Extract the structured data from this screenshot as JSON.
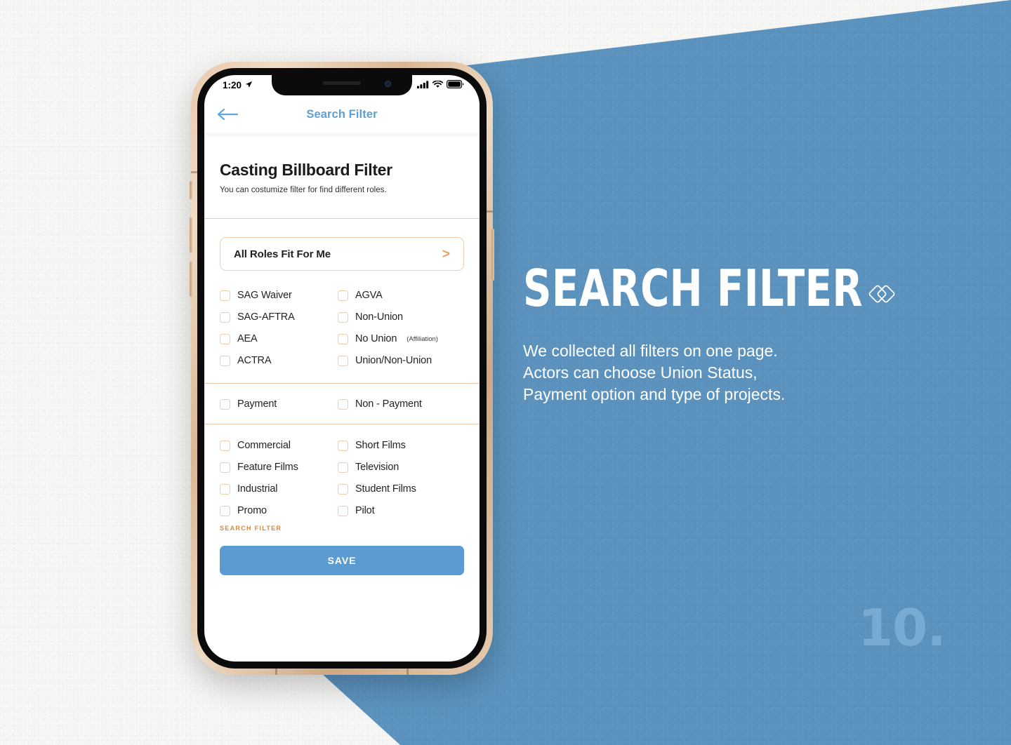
{
  "background": {
    "paper_color": "#f5f5f4",
    "accent_blue": "#5b92bd"
  },
  "right_panel": {
    "headline": "SEARCH FILTER",
    "body_lines": [
      "We collected all filters on one page.",
      "Actors can choose Union Status,",
      "Payment option and type of projects."
    ],
    "logo_icon": "double-diamond-icon",
    "page_number": "10."
  },
  "phone": {
    "status_bar": {
      "time": "1:20",
      "location_icon": "location-arrow-icon",
      "signal_icon": "cellular-signal-icon",
      "wifi_icon": "wifi-icon",
      "battery_icon": "battery-full-icon"
    },
    "nav": {
      "back_icon": "back-arrow-icon",
      "title": "Search Filter",
      "title_color": "#5c9fd6"
    },
    "intro": {
      "title": "Casting Billboard Filter",
      "subtitle": "You can costumize filter for find different roles."
    },
    "select": {
      "label": "All Roles Fit For Me",
      "chevron_icon": "chevron-right-icon",
      "border_color": "#f0cdac"
    },
    "union_group": [
      {
        "left": "SAG Waiver",
        "right": "AGVA"
      },
      {
        "left": "SAG-AFTRA",
        "right": "Non-Union"
      },
      {
        "left": "AEA",
        "right": "No Union",
        "right_note": "(Affiliation)"
      },
      {
        "left": "ACTRA",
        "right": "Union/Non-Union"
      }
    ],
    "payment_group": [
      {
        "left": "Payment",
        "right": "Non - Payment"
      }
    ],
    "type_group": [
      {
        "left": "Commercial",
        "right": "Short Films"
      },
      {
        "left": "Feature Films",
        "right": "Television"
      },
      {
        "left": "Industrial",
        "right": "Student Films"
      },
      {
        "left": "Promo",
        "right": "Pilot"
      }
    ],
    "footer_tag": "SEARCH FILTER",
    "save_label": "SAVE",
    "save_color": "#5b9bd1"
  }
}
